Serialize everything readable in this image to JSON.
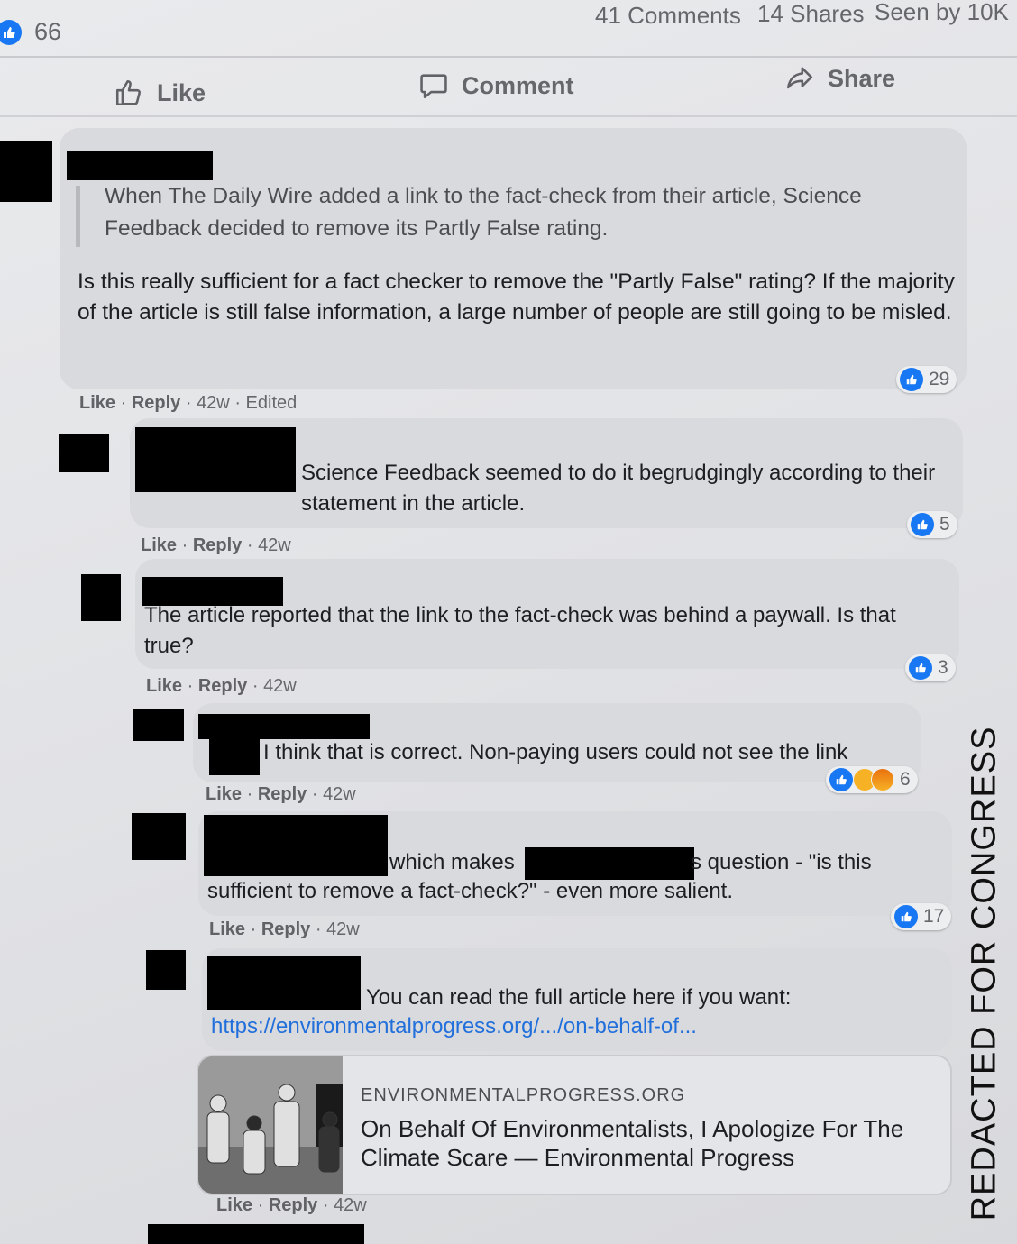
{
  "post_stats": {
    "reaction_count": "66",
    "comments": "41 Comments",
    "shares": "14 Shares",
    "seen_by": "Seen by 10K"
  },
  "actions": {
    "like": "Like",
    "comment": "Comment",
    "share": "Share"
  },
  "comments": [
    {
      "quote": "When The Daily Wire added a link to the fact-check from their article, Science Feedback decided to remove its Partly False rating.",
      "text": "Is this really sufficient for a fact checker to remove the \"Partly False\" rating? If the majority of the article is still false information, a large number of people are still going to be misled.",
      "like": "Like",
      "reply": "Reply",
      "time": "42w",
      "edited": "Edited",
      "reactions": "29"
    },
    {
      "text": "Science Feedback seemed to do it begrudgingly according to their statement in the article.",
      "like": "Like",
      "reply": "Reply",
      "time": "42w",
      "reactions": "5"
    },
    {
      "text": "The article reported that the link to the fact-check was behind a paywall. Is that true?",
      "like": "Like",
      "reply": "Reply",
      "time": "42w",
      "reactions": "3"
    },
    {
      "text": "I think that is correct. Non-paying users could not see the link",
      "like": "Like",
      "reply": "Reply",
      "time": "42w",
      "reactions": "6"
    },
    {
      "text_a": "which makes",
      "text_b": "s question - \"is this",
      "text_c": "sufficient to remove a fact-check?\" - even more salient.",
      "like": "Like",
      "reply": "Reply",
      "time": "42w",
      "reactions": "17"
    },
    {
      "text": "You can read the full article here if you want:",
      "link": "https://environmentalprogress.org/.../on-behalf-of...",
      "like": "Like",
      "reply": "Reply",
      "time": "42w"
    }
  ],
  "link_preview": {
    "domain": "ENVIRONMENTALPROGRESS.ORG",
    "title": "On Behalf Of Environmentalists, I Apologize For The Climate Scare — Environmental Progress"
  },
  "watermark": "REDACTED FOR CONGRESS"
}
